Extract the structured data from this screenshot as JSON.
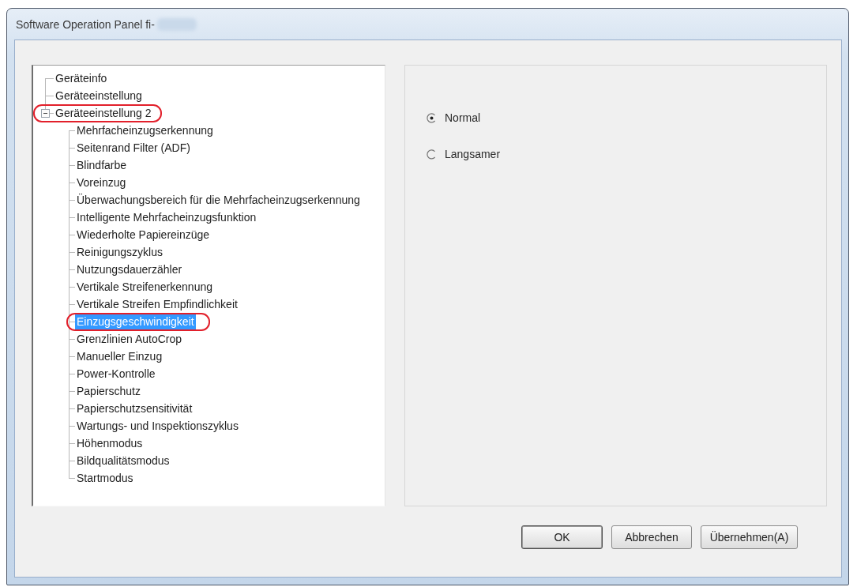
{
  "window": {
    "title": "Software Operation Panel fi-"
  },
  "tree": {
    "items": [
      {
        "label": "Geräteinfo",
        "selected": false,
        "circled": false
      },
      {
        "label": "Geräteeinstellung",
        "selected": false,
        "circled": false
      },
      {
        "label": "Geräteeinstellung 2",
        "selected": false,
        "circled": true,
        "expanded": true,
        "children": [
          {
            "label": "Mehrfacheinzugserkennung",
            "selected": false,
            "circled": false
          },
          {
            "label": "Seitenrand Filter (ADF)",
            "selected": false,
            "circled": false
          },
          {
            "label": "Blindfarbe",
            "selected": false,
            "circled": false
          },
          {
            "label": "Voreinzug",
            "selected": false,
            "circled": false
          },
          {
            "label": "Überwachungsbereich für die Mehrfacheinzugserkennung",
            "selected": false,
            "circled": false
          },
          {
            "label": "Intelligente Mehrfacheinzugsfunktion",
            "selected": false,
            "circled": false
          },
          {
            "label": "Wiederholte Papiereinzüge",
            "selected": false,
            "circled": false
          },
          {
            "label": "Reinigungszyklus",
            "selected": false,
            "circled": false
          },
          {
            "label": "Nutzungsdauerzähler",
            "selected": false,
            "circled": false
          },
          {
            "label": "Vertikale Streifenerkennung",
            "selected": false,
            "circled": false
          },
          {
            "label": "Vertikale Streifen Empfindlichkeit",
            "selected": false,
            "circled": false
          },
          {
            "label": "Einzugsgeschwindigkeit",
            "selected": true,
            "circled": true
          },
          {
            "label": "Grenzlinien AutoCrop",
            "selected": false,
            "circled": false
          },
          {
            "label": "Manueller Einzug",
            "selected": false,
            "circled": false
          },
          {
            "label": "Power-Kontrolle",
            "selected": false,
            "circled": false
          },
          {
            "label": "Papierschutz",
            "selected": false,
            "circled": false
          },
          {
            "label": "Papierschutzsensitivität",
            "selected": false,
            "circled": false
          },
          {
            "label": "Wartungs- und Inspektionszyklus",
            "selected": false,
            "circled": false
          },
          {
            "label": "Höhenmodus",
            "selected": false,
            "circled": false
          },
          {
            "label": "Bildqualitätsmodus",
            "selected": false,
            "circled": false
          },
          {
            "label": "Startmodus",
            "selected": false,
            "circled": false
          }
        ]
      }
    ]
  },
  "speed_options": [
    {
      "label": "Normal",
      "selected": true
    },
    {
      "label": "Langsamer",
      "selected": false
    }
  ],
  "buttons": [
    {
      "label": "OK",
      "default": true
    },
    {
      "label": "Abbrechen",
      "default": false
    },
    {
      "label": "Übernehmen(A)",
      "default": false
    }
  ]
}
